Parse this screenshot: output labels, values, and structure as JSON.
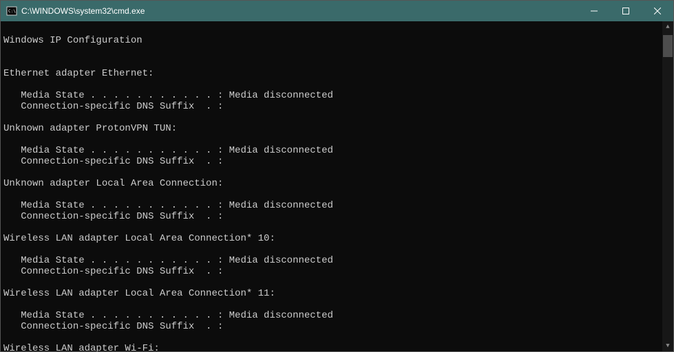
{
  "title": "C:\\WINDOWS\\system32\\cmd.exe",
  "header": "Windows IP Configuration",
  "adapters": [
    {
      "name": "Ethernet adapter Ethernet:",
      "lines": [
        "   Media State . . . . . . . . . . . : Media disconnected",
        "   Connection-specific DNS Suffix  . :"
      ]
    },
    {
      "name": "Unknown adapter ProtonVPN TUN:",
      "lines": [
        "   Media State . . . . . . . . . . . : Media disconnected",
        "   Connection-specific DNS Suffix  . :"
      ]
    },
    {
      "name": "Unknown adapter Local Area Connection:",
      "lines": [
        "   Media State . . . . . . . . . . . : Media disconnected",
        "   Connection-specific DNS Suffix  . :"
      ]
    },
    {
      "name": "Wireless LAN adapter Local Area Connection* 10:",
      "lines": [
        "   Media State . . . . . . . . . . . : Media disconnected",
        "   Connection-specific DNS Suffix  . :"
      ]
    },
    {
      "name": "Wireless LAN adapter Local Area Connection* 11:",
      "lines": [
        "   Media State . . . . . . . . . . . : Media disconnected",
        "   Connection-specific DNS Suffix  . :"
      ]
    },
    {
      "name": "Wireless LAN adapter Wi-Fi:",
      "lines": []
    }
  ]
}
